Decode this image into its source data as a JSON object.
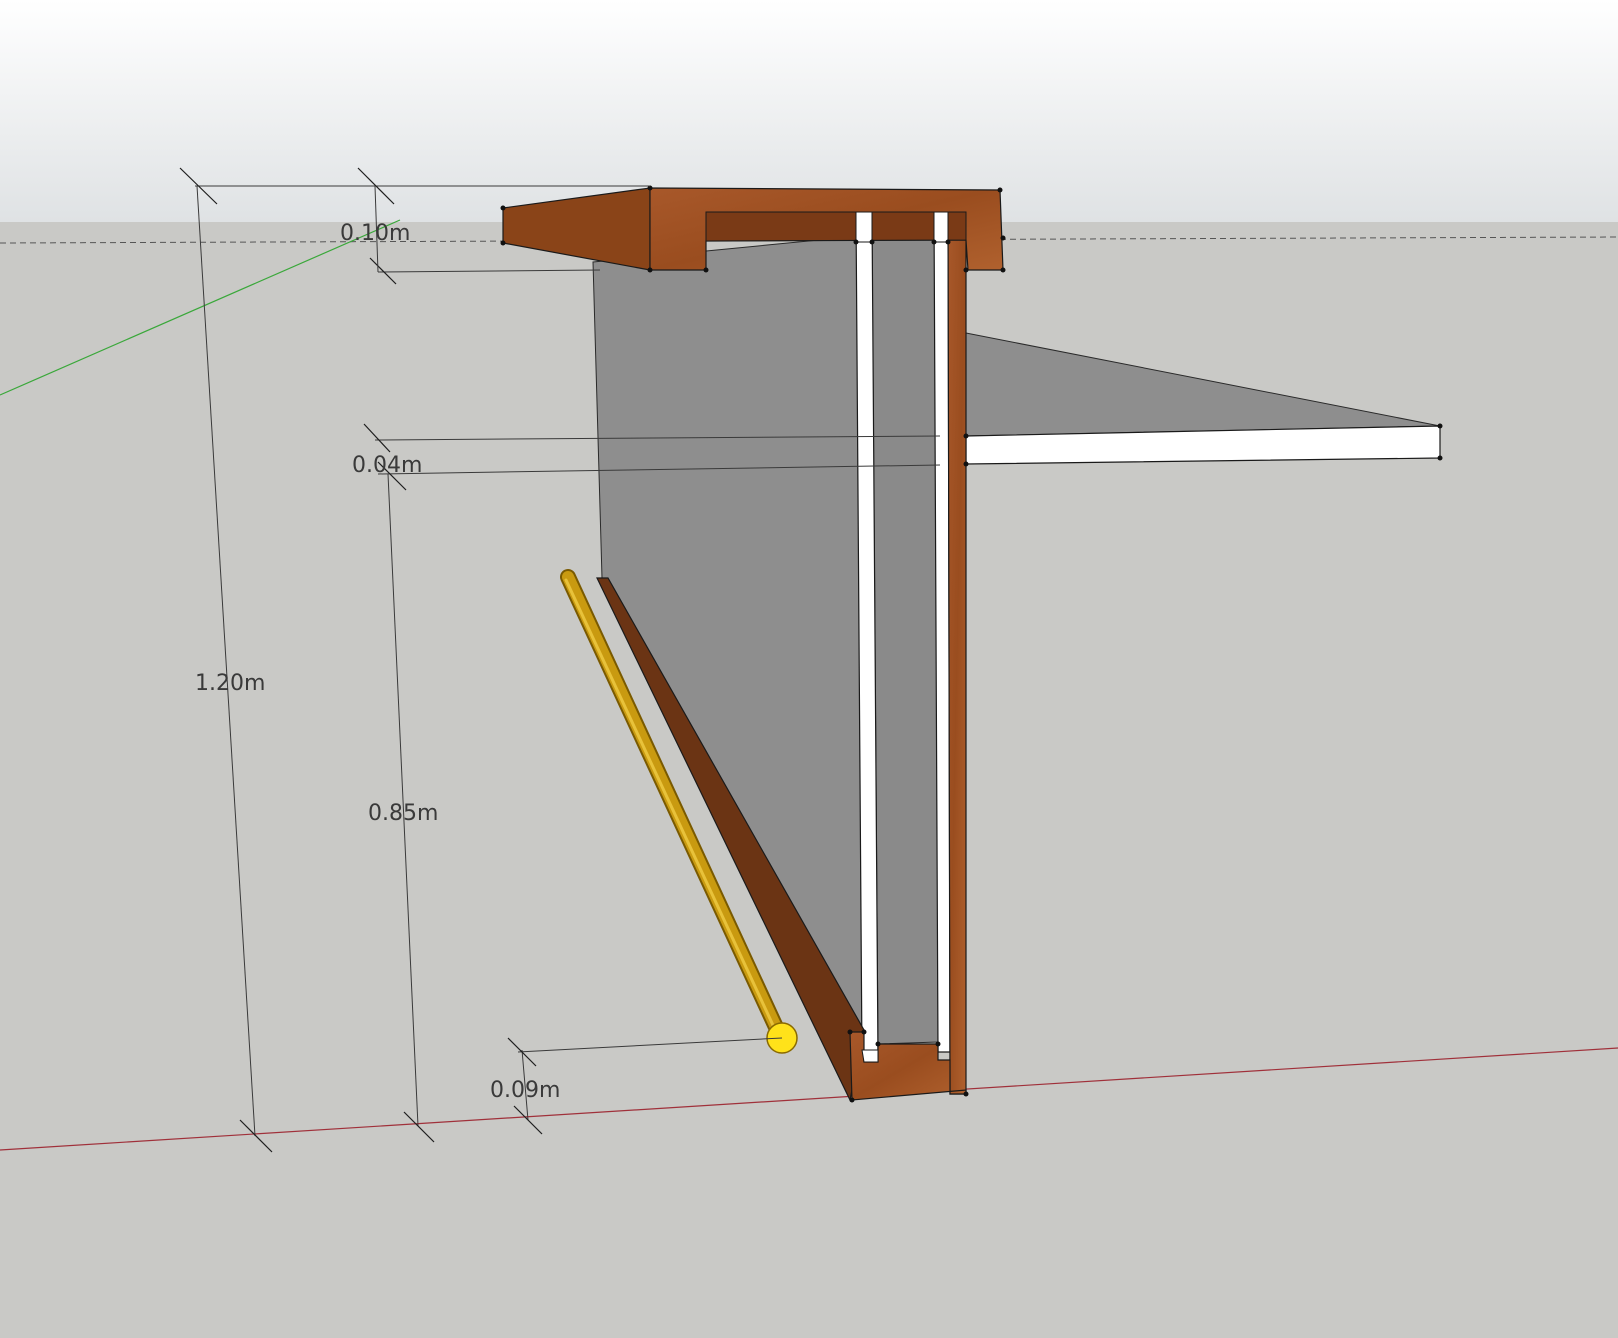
{
  "scene": {
    "colors": {
      "sky_top": "#ffffff",
      "sky_bottom": "#dfe2e4",
      "ground": "#c9c9c6",
      "wood": "#9a4d1f",
      "wood_dark": "#6b3414",
      "panel": "#8e8e8e",
      "shelf": "#ffffff",
      "rod": "#c99a10",
      "rod_end": "#ffe21a",
      "x_axis": "#a0303a",
      "y_axis": "#3aa83a"
    }
  },
  "dimensions": {
    "top_thickness": "0.10m",
    "shelf_thickness": "0.04m",
    "total_height": "1.20m",
    "shelf_height": "0.85m",
    "rod_offset": "0.09m"
  }
}
